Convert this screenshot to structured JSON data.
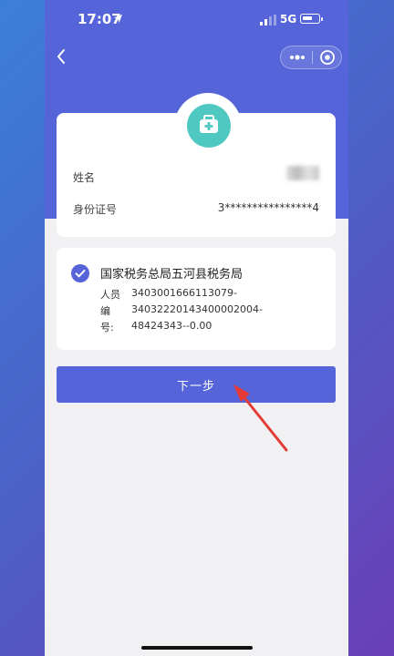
{
  "status_bar": {
    "time": "17:07",
    "network": "5G"
  },
  "info_card": {
    "name_label": "姓名",
    "id_label": "身份证号",
    "id_value": "3****************4"
  },
  "tax_office": {
    "name": "国家税务总局五河县税务局",
    "details": [
      {
        "label": "人员",
        "value": "3403001666113079-"
      },
      {
        "label": "编",
        "value": "34032220143400002004-"
      },
      {
        "label": "号:",
        "value": "48424343--0.00"
      }
    ]
  },
  "next_button": {
    "label": "下一步"
  },
  "colors": {
    "primary": "#5565d9",
    "icon_teal": "#4fc8c2",
    "annotation_arrow": "#e53935"
  },
  "icons": [
    "location-arrow-icon",
    "signal-icon",
    "battery-icon",
    "back-chevron-icon",
    "more-dots-icon",
    "target-circle-icon",
    "medical-kit-icon",
    "check-circle-icon",
    "red-arrow-annotation"
  ]
}
